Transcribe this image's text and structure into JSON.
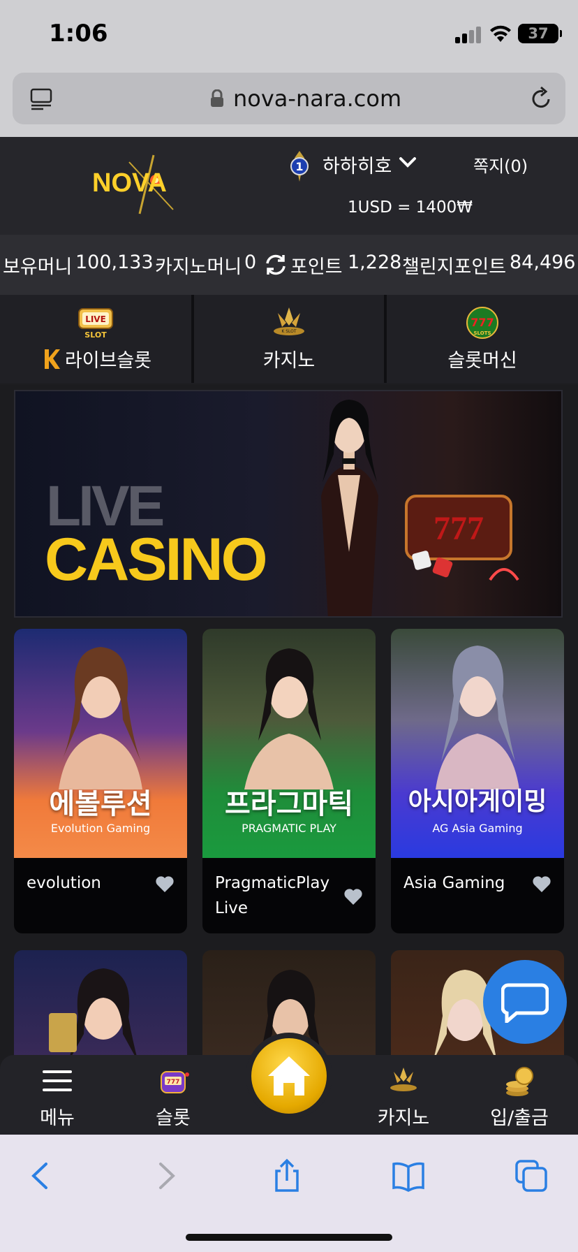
{
  "status_bar": {
    "time": "1:06",
    "battery": "37"
  },
  "browser": {
    "url": "nova-nara.com"
  },
  "header": {
    "logo_text": "NOVA",
    "level": "1",
    "username": "하하히호",
    "messages": "쪽지(0)",
    "exchange_rate": "1USD = 1400₩"
  },
  "balance": {
    "money_label": "보유머니",
    "money_value": "100,133",
    "casino_label": "카지노머니",
    "casino_value": "0",
    "points_label": "포인트",
    "points_value": "1,228",
    "challenge_label": "챌린지포인트",
    "challenge_value": "84,496"
  },
  "categories": [
    {
      "label": "라이브슬롯",
      "icon": "live-slot-icon"
    },
    {
      "label": "카지노",
      "icon": "casino-icon"
    },
    {
      "label": "슬롯머신",
      "icon": "slot-machine-icon"
    }
  ],
  "banner": {
    "line1": "LIVE",
    "line2": "CASINO"
  },
  "games": [
    {
      "title": "evolution",
      "kr_title": "에볼루션",
      "brand": "Evolution Gaming"
    },
    {
      "title": "PragmaticPlay Live",
      "kr_title": "프라그마틱",
      "brand": "PRAGMATIC PLAY"
    },
    {
      "title": "Asia Gaming",
      "kr_title": "아시아게이밍",
      "brand": "AG Asia Gaming"
    }
  ],
  "bottom_nav": {
    "menu": "메뉴",
    "slot": "슬롯",
    "casino": "카지노",
    "deposit": "입/출금"
  },
  "colors": {
    "accent_gold": "#f7c91c",
    "chat_blue": "#2a7fe3",
    "bg": "#1c1c1f"
  }
}
